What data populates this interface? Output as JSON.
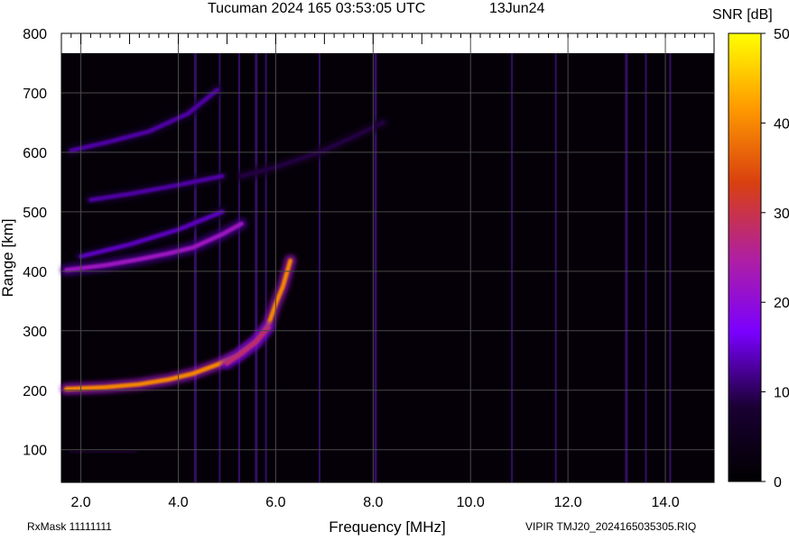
{
  "header": {
    "title": "Tucuman 2024 165 03:53:05 UTC",
    "date": "13Jun24"
  },
  "footer": {
    "rxmask": "RxMask 11111111",
    "file": "VIPIR  TMJ20_2024165035305.RIQ"
  },
  "colorbar": {
    "label": "SNR [dB]",
    "ticks": [
      0,
      10,
      20,
      30,
      40,
      50
    ],
    "range": [
      0,
      50
    ],
    "colors": [
      "#000000",
      "#1a0033",
      "#7a00ff",
      "#b020a0",
      "#d94010",
      "#ff9a00",
      "#ffff00"
    ]
  },
  "chart_data": {
    "type": "heatmap",
    "title": "Tucuman 2024 165 03:53:05 UTC",
    "xlabel": "Frequency [MHz]",
    "ylabel": "Range [km]",
    "xlim": [
      1.6,
      15.0
    ],
    "ylim": [
      45,
      800
    ],
    "x_ticks": [
      2.0,
      4.0,
      6.0,
      8.0,
      10.0,
      12.0,
      14.0
    ],
    "x_tick_labels": [
      "2.0",
      "4.0",
      "6.0",
      "8.0",
      "10.0",
      "12.0",
      "14.0"
    ],
    "y_ticks": [
      100,
      200,
      300,
      400,
      500,
      600,
      700,
      800
    ],
    "grid": true,
    "traces": [
      {
        "name": "",
        "points": [
          [
            1.7,
            202
          ],
          [
            2.5,
            205
          ],
          [
            3.2,
            210
          ],
          [
            3.8,
            218
          ],
          [
            4.3,
            228
          ],
          [
            4.8,
            243
          ],
          [
            5.2,
            258
          ],
          [
            5.6,
            282
          ],
          [
            5.85,
            310
          ],
          [
            6.0,
            345
          ],
          [
            6.15,
            375
          ],
          [
            6.3,
            418
          ]
        ],
        "snr": 40
      },
      {
        "name": "",
        "points": [
          [
            5.0,
            245
          ],
          [
            5.3,
            262
          ],
          [
            5.6,
            282
          ],
          [
            5.85,
            305
          ]
        ],
        "snr": 28
      },
      {
        "name": "",
        "points": [
          [
            1.7,
            402
          ],
          [
            2.5,
            410
          ],
          [
            3.2,
            420
          ],
          [
            3.8,
            430
          ],
          [
            4.3,
            440
          ],
          [
            4.9,
            462
          ],
          [
            5.3,
            480
          ]
        ],
        "snr": 22
      },
      {
        "name": "",
        "points": [
          [
            2.0,
            425
          ],
          [
            3.0,
            445
          ],
          [
            4.0,
            470
          ],
          [
            4.9,
            500
          ]
        ],
        "snr": 14
      },
      {
        "name": "",
        "points": [
          [
            2.2,
            520
          ],
          [
            3.0,
            530
          ],
          [
            4.0,
            545
          ],
          [
            4.9,
            560
          ]
        ],
        "snr": 13
      },
      {
        "name": "",
        "points": [
          [
            1.8,
            603
          ],
          [
            2.6,
            618
          ],
          [
            3.4,
            635
          ],
          [
            4.2,
            665
          ],
          [
            4.8,
            705
          ]
        ],
        "snr": 13
      },
      {
        "name": "",
        "points": [
          [
            5.3,
            560
          ],
          [
            6.0,
            575
          ],
          [
            6.9,
            600
          ],
          [
            7.7,
            630
          ],
          [
            8.2,
            650
          ]
        ],
        "snr": 9
      },
      {
        "name": "",
        "points": [
          [
            1.8,
            95
          ],
          [
            2.4,
            96
          ],
          [
            3.1,
            97
          ]
        ],
        "snr": 6
      }
    ],
    "vertical_interference_mhz": [
      4.35,
      4.85,
      5.25,
      5.6,
      5.8,
      6.9,
      8.05,
      10.85,
      11.75,
      13.2,
      13.6,
      14.1
    ]
  }
}
